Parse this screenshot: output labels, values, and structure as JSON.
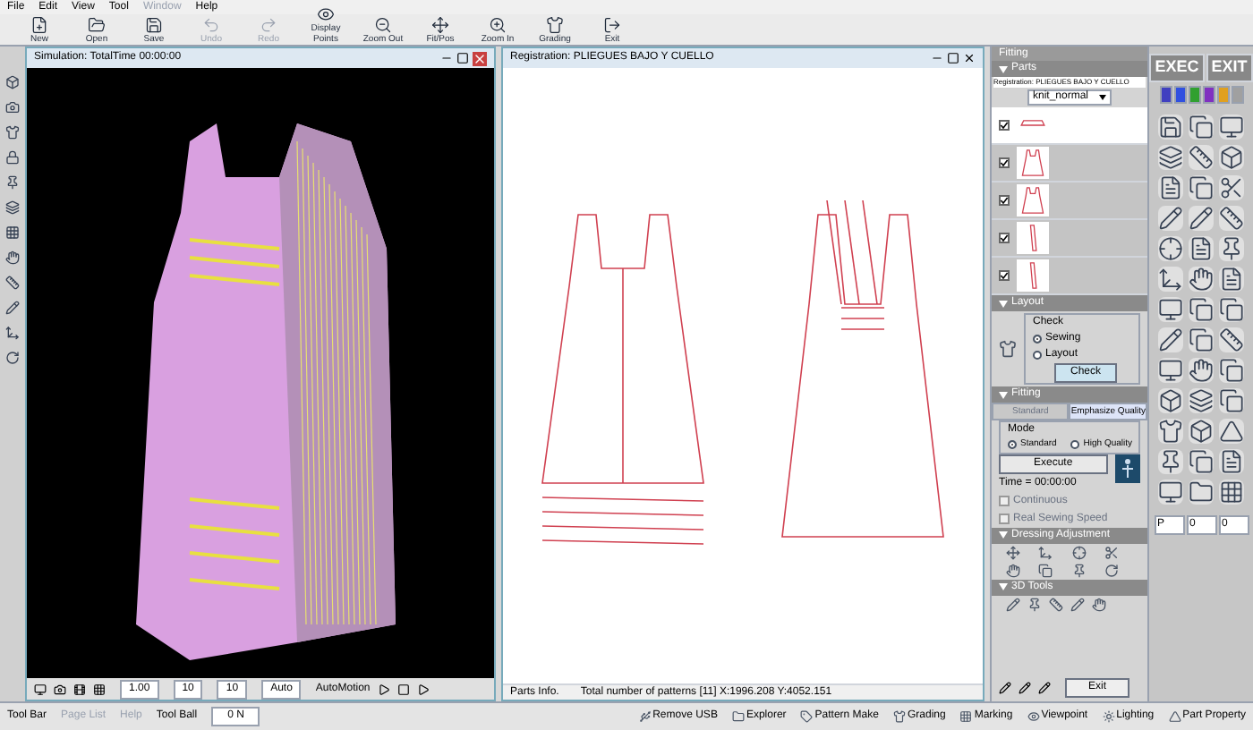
{
  "menu": [
    {
      "label": "File",
      "disabled": false
    },
    {
      "label": "Edit",
      "disabled": false
    },
    {
      "label": "View",
      "disabled": false
    },
    {
      "label": "Tool",
      "disabled": false
    },
    {
      "label": "Window",
      "disabled": true
    },
    {
      "label": "Help",
      "disabled": false
    }
  ],
  "toolbar": [
    {
      "label": "New",
      "kind": "new",
      "disabled": false
    },
    {
      "label": "Open",
      "kind": "open",
      "disabled": false
    },
    {
      "label": "Save",
      "kind": "save",
      "disabled": false
    },
    {
      "label": "Undo",
      "kind": "undo",
      "disabled": true
    },
    {
      "label": "Redo",
      "kind": "redo",
      "disabled": true
    },
    {
      "label": "Display Points",
      "kind": "points",
      "disabled": false
    },
    {
      "label": "Zoom Out",
      "kind": "zoomout",
      "disabled": false
    },
    {
      "label": "Fit/Pos",
      "kind": "fit",
      "disabled": false
    },
    {
      "label": "Zoom In",
      "kind": "zoomin",
      "disabled": false
    },
    {
      "label": "Grading",
      "kind": "grading",
      "disabled": false
    },
    {
      "label": "Exit",
      "kind": "exit",
      "disabled": false
    }
  ],
  "simulation": {
    "title": "Simulation: TotalTime 00:00:00",
    "controls": [
      "1.00",
      "10",
      "10",
      "Auto"
    ],
    "automotion": "AutoMotion"
  },
  "pattern_window": {
    "title": "Registration: PLIEGUES BAJO Y CUELLO",
    "parts_info": "Parts Info.",
    "status": "Total number of patterns [11]  X:1996.208 Y:4052.151"
  },
  "fitting": {
    "title": "Fitting",
    "parts_header": "Parts",
    "registration": "Registration: PLIEGUES BAJO Y CUELLO",
    "fabric": "knit_normal",
    "parts": [
      {
        "checked": true,
        "selected": true,
        "kind": "band"
      },
      {
        "checked": true,
        "selected": false,
        "kind": "dress"
      },
      {
        "checked": true,
        "selected": false,
        "kind": "dress"
      },
      {
        "checked": true,
        "selected": false,
        "kind": "strap"
      },
      {
        "checked": true,
        "selected": false,
        "kind": "strap"
      }
    ],
    "layout_header": "Layout",
    "check_group": "Check",
    "check_options": [
      {
        "label": "Sewing",
        "selected": true
      },
      {
        "label": "Layout",
        "selected": false
      }
    ],
    "check_button": "Check",
    "fitting_header": "Fitting",
    "tabs": [
      {
        "label": "Standard",
        "selected": false
      },
      {
        "label": "Emphasize Quality",
        "selected": true
      }
    ],
    "mode_group": "Mode",
    "modes": [
      {
        "label": "Standard",
        "selected": true
      },
      {
        "label": "High Quality",
        "selected": false
      }
    ],
    "execute": "Execute",
    "time": "Time = 00:00:00",
    "options": [
      {
        "label": "Continuous",
        "checked": false
      },
      {
        "label": "Real Sewing Speed",
        "checked": false
      }
    ],
    "dressing_header": "Dressing Adjustment",
    "tools_header": "3D Tools",
    "exit": "Exit"
  },
  "palette": {
    "exec": "EXEC",
    "exit": "EXIT",
    "pens": [
      {
        "color": "#4040c0"
      },
      {
        "color": "#3050e0"
      },
      {
        "color": "#30a030"
      },
      {
        "color": "#8030c0"
      },
      {
        "color": "#e0a020"
      },
      {
        "color": "#a0a0a0"
      }
    ],
    "fields": [
      "P",
      "0",
      "0"
    ]
  },
  "status_bar": {
    "left": [
      "Tool Bar",
      "Page List",
      "Help"
    ],
    "tool_ball": "Tool Ball",
    "value": "0 N",
    "tasks": [
      "Remove USB",
      "Explorer",
      "Pattern Make",
      "Grading",
      "Marking",
      "Viewpoint",
      "Lighting",
      "Part Property"
    ]
  }
}
